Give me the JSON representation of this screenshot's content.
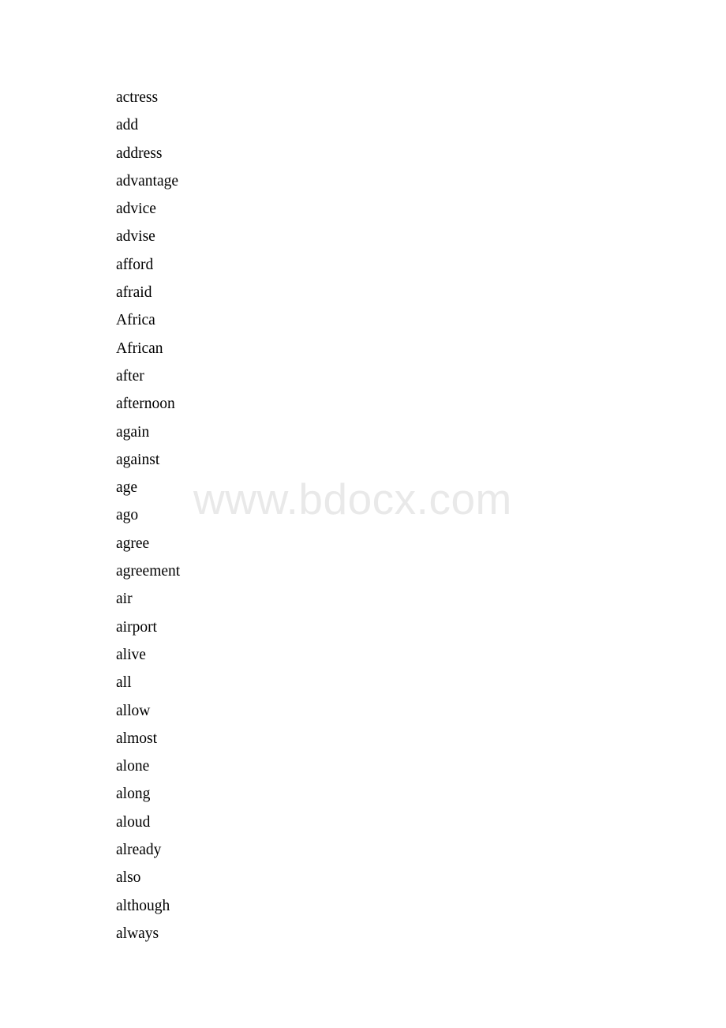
{
  "document": {
    "type": "word-list",
    "background_color": "#ffffff",
    "text_color": "#000000"
  },
  "watermark": {
    "text": "www.bdocx.com",
    "color": "#e9e9e9"
  },
  "word_list": {
    "words": [
      "actress",
      "add",
      "address",
      "advantage",
      "advice",
      "advise",
      "afford",
      "afraid",
      "Africa",
      "African",
      "after",
      "afternoon",
      "again",
      "against",
      "age",
      "ago",
      "agree",
      "agreement",
      "air",
      "airport",
      "alive",
      "all",
      "allow",
      "almost",
      "alone",
      "along",
      "aloud",
      "already",
      "also",
      "although",
      "always"
    ]
  }
}
